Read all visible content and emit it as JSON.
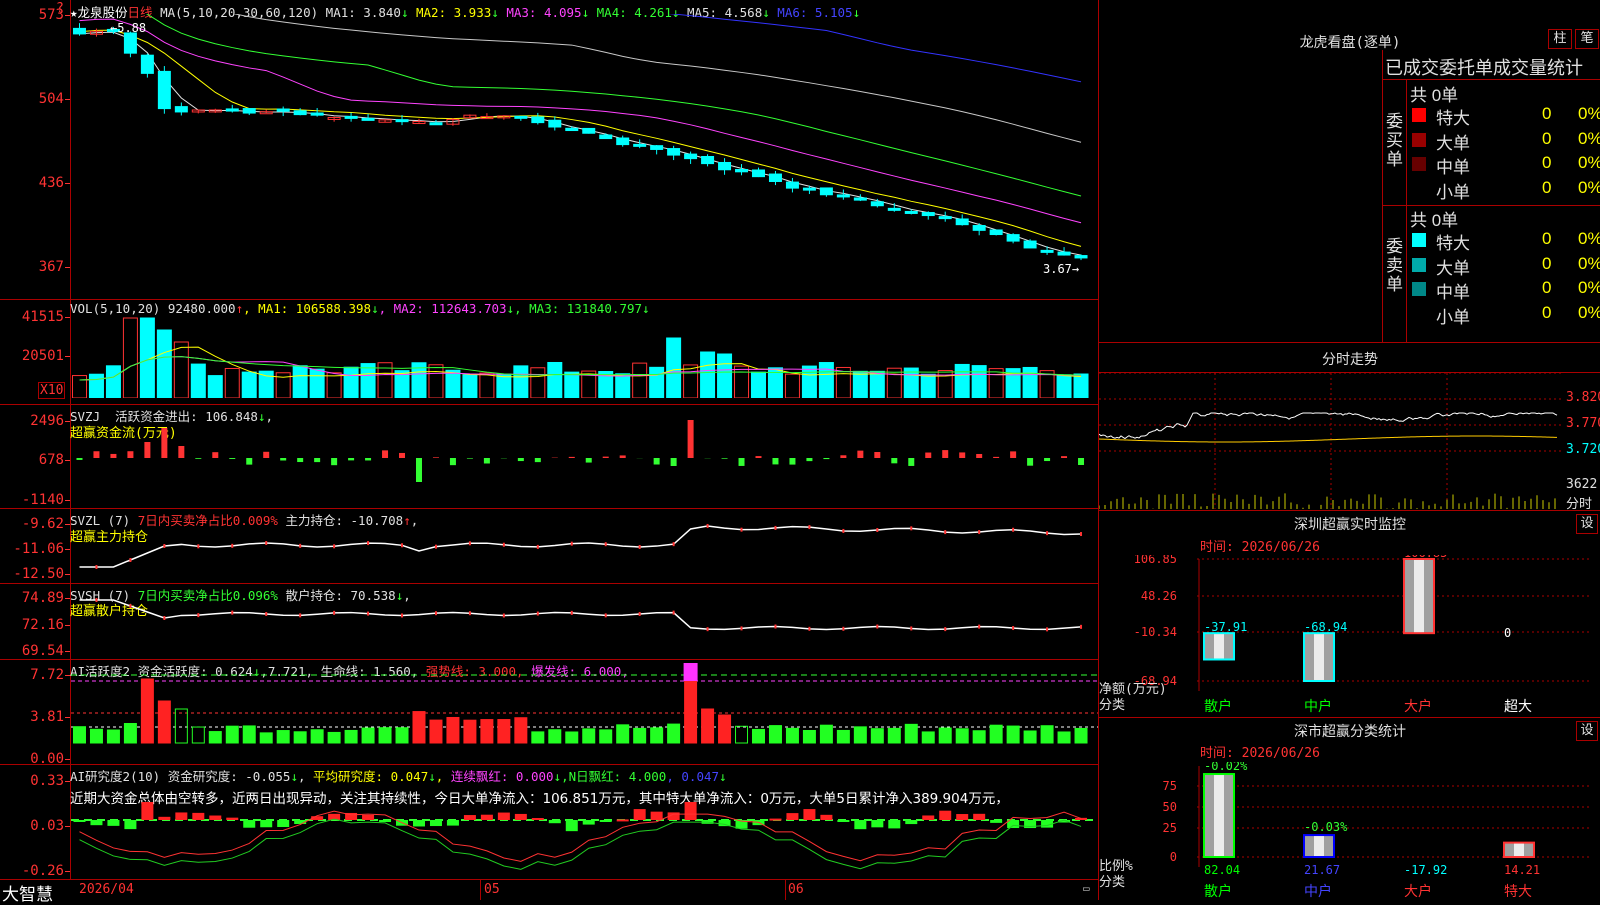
{
  "colors": {
    "up": "#ff3333",
    "down": "#00ffff",
    "grid": "#aa0000",
    "bg": "#000000"
  },
  "main_chart": {
    "star": "★",
    "stock_name": "龙泉股份",
    "period": "日线",
    "ma_label": "MA(5,10,20,30,60,120)",
    "ma": [
      {
        "name": "MA1:",
        "value": "3.840",
        "arrow": "↓",
        "color": "#e0e0e0"
      },
      {
        "name": "MA2:",
        "value": "3.933",
        "arrow": "↓",
        "color": "#ffff00"
      },
      {
        "name": "MA3:",
        "value": "4.095",
        "arrow": "↓",
        "color": "#ff44ff"
      },
      {
        "name": "MA4:",
        "value": "4.261",
        "arrow": "↓",
        "color": "#33ff33"
      },
      {
        "name": "MA5:",
        "value": "4.568",
        "arrow": "↓",
        "color": "#e0e0e0"
      },
      {
        "name": "MA6:",
        "value": "5.105",
        "arrow": "↓",
        "color": "#4444ff"
      }
    ],
    "y_labels": [
      "573",
      "504",
      "436",
      "367"
    ],
    "high_marker": "5.88",
    "low_marker": "3.67",
    "ylim": [
      3.5,
      5.95
    ]
  },
  "vol": {
    "label": "VOL(5,10,20)",
    "value": "92480.000",
    "arrow": "↑",
    "ma1": "MA1: 106588.398",
    "ma1_arrow": "↓",
    "ma2": "MA2: 112643.703",
    "ma2_arrow": "↓",
    "ma3": "MA3: 131840.797",
    "ma3_arrow": "↓",
    "y_labels": [
      "41515",
      "20501"
    ],
    "unit": "X10"
  },
  "svzj": {
    "name": "SVZJ",
    "title": "活跃资金进出:",
    "value": "106.848",
    "arrow": "↓",
    "subtitle": "超赢资金流(万元)",
    "y_labels": [
      "2496",
      "678",
      "-1140"
    ]
  },
  "svzl": {
    "name": "SVZL (7)",
    "pct_label": "7日内买卖净占比0.009%",
    "hold_label": "主力持仓:",
    "hold_value": "-10.708",
    "arrow": "↑",
    "trail": ",",
    "subtitle": "超赢主力持仓",
    "y_labels": [
      "-9.62",
      "-11.06",
      "-12.50"
    ]
  },
  "svsh": {
    "name": "SVSH (7)",
    "pct_label": "7日内买卖净占比0.096%",
    "hold_label": "散户持仓:",
    "hold_value": "70.538",
    "arrow": "↓",
    "trail": ",",
    "subtitle": "超赢散户持仓",
    "y_labels": [
      "74.89",
      "72.16",
      "69.54"
    ]
  },
  "ai_active": {
    "name": "AI活跃度2",
    "l1": "资金活跃度:",
    "v1": "0.624",
    "a1": "↓",
    "v2": "7.721",
    "l3": "生命线:",
    "v3": "1.560",
    "strong": "强势线:",
    "strong_v": "3.000",
    "burst": "爆发线:",
    "burst_v": "6.000",
    "y_labels": [
      "7.72",
      "3.81",
      "0.00"
    ]
  },
  "ai_research": {
    "name": "AI研究度2(10)",
    "l1": "资金研究度:",
    "v1": "-0.055",
    "a1": "↓",
    "l2": "平均研究度:",
    "v2": "0.047",
    "a2": "↓",
    "l3": "连续飘红:",
    "v3": "0.000",
    "a3": "↓",
    "l4": "N日飘红:",
    "v4": "4.000",
    "v5": "0.047",
    "a5": "↓",
    "note": "近期大资金总体由空转多，近两日出现异动，关注其持续性，今日大单净流入：106.851万元，其中特大单净流入：0万元，大单5日累计净入389.904万元，",
    "y_labels": [
      "0.33",
      "0.03",
      "-0.26"
    ]
  },
  "footer": {
    "brand": "大智慧",
    "dates": [
      "2026/04",
      "05",
      "06"
    ]
  },
  "longhu": {
    "title": "龙虎看盘(逐单)",
    "btn1": "柱",
    "btn2": "笔",
    "table_title": "已成交委托单成交量统计",
    "buy": {
      "side": "委买单",
      "total": "共 0单",
      "rows": [
        {
          "label": "特大",
          "v": "0",
          "p": "0%",
          "color": "#ff0000"
        },
        {
          "label": "大单",
          "v": "0",
          "p": "0%",
          "color": "#990000"
        },
        {
          "label": "中单",
          "v": "0",
          "p": "0%",
          "color": "#660000"
        },
        {
          "label": "小单",
          "v": "0",
          "p": "0%",
          "color": "#000000"
        }
      ]
    },
    "sell": {
      "side": "委卖单",
      "total": "共 0单",
      "rows": [
        {
          "label": "特大",
          "v": "0",
          "p": "0%",
          "color": "#00ffff"
        },
        {
          "label": "大单",
          "v": "0",
          "p": "0%",
          "color": "#00aaaa"
        },
        {
          "label": "中单",
          "v": "0",
          "p": "0%",
          "color": "#008888"
        },
        {
          "label": "小单",
          "v": "0",
          "p": "0%",
          "color": "#000000"
        }
      ]
    }
  },
  "intraday": {
    "title": "分时走势",
    "y_labels": [
      "3.820",
      "3.770",
      "3.720"
    ],
    "vol_label": "3622",
    "vol_unit": "分时"
  },
  "sz_monitor": {
    "title": "深圳超赢实时监控",
    "btn": "设",
    "time": "时间: 2026/06/26",
    "y_labels": [
      "106.85",
      "48.26",
      "-10.34",
      "-68.94"
    ],
    "unit": "净额(万元)",
    "cat_label": "分类",
    "chart_data": {
      "type": "bar",
      "categories": [
        "散户",
        "中户",
        "大户",
        "超大"
      ],
      "values": [
        -37.91,
        -68.94,
        106.85,
        0
      ],
      "value_labels": [
        "-37.91",
        "-68.94",
        "106.85",
        "0"
      ],
      "ylim": [
        -68.94,
        106.85
      ]
    }
  },
  "sz_class": {
    "title": "深市超赢分类统计",
    "btn": "设",
    "time": "时间: 2026/06/26",
    "y_labels": [
      "75",
      "50",
      "25",
      "0"
    ],
    "unit": "比例%",
    "cat_label": "分类",
    "chart_data": {
      "type": "bar",
      "categories": [
        "散户",
        "中户",
        "大户",
        "特大"
      ],
      "values": [
        82.04,
        21.67,
        -17.92,
        14.21
      ],
      "value_labels": [
        "82.04",
        "21.67",
        "-17.92",
        "14.21"
      ],
      "top_labels": [
        "-0.02%",
        "-0.03%",
        "",
        ""
      ],
      "ylim": [
        0,
        90
      ]
    }
  }
}
